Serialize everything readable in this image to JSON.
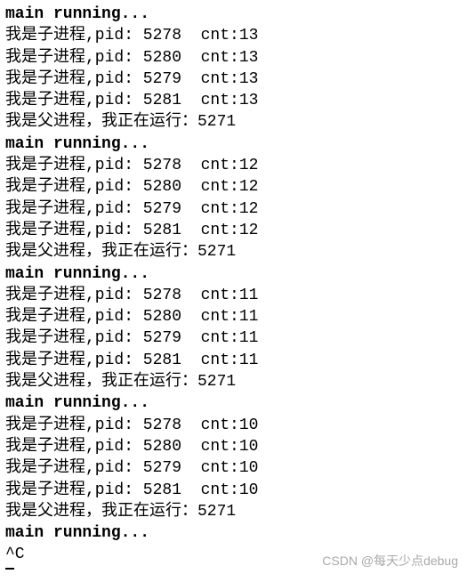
{
  "terminal": {
    "blocks": [
      {
        "header": "main running...",
        "children": [
          {
            "prefix": "我是子进程,pid: ",
            "pid": "5278",
            "sep": "  cnt:",
            "cnt": "13"
          },
          {
            "prefix": "我是子进程,pid: ",
            "pid": "5280",
            "sep": "  cnt:",
            "cnt": "13"
          },
          {
            "prefix": "我是子进程,pid: ",
            "pid": "5279",
            "sep": "  cnt:",
            "cnt": "13"
          },
          {
            "prefix": "我是子进程,pid: ",
            "pid": "5281",
            "sep": "  cnt:",
            "cnt": "13"
          }
        ],
        "parent": {
          "prefix": "我是父进程，我正在运行：",
          "pid": "5271"
        }
      },
      {
        "header": "main running...",
        "children": [
          {
            "prefix": "我是子进程,pid: ",
            "pid": "5278",
            "sep": "  cnt:",
            "cnt": "12"
          },
          {
            "prefix": "我是子进程,pid: ",
            "pid": "5280",
            "sep": "  cnt:",
            "cnt": "12"
          },
          {
            "prefix": "我是子进程,pid: ",
            "pid": "5279",
            "sep": "  cnt:",
            "cnt": "12"
          },
          {
            "prefix": "我是子进程,pid: ",
            "pid": "5281",
            "sep": "  cnt:",
            "cnt": "12"
          }
        ],
        "parent": {
          "prefix": "我是父进程，我正在运行：",
          "pid": "5271"
        }
      },
      {
        "header": "main running...",
        "children": [
          {
            "prefix": "我是子进程,pid: ",
            "pid": "5278",
            "sep": "  cnt:",
            "cnt": "11"
          },
          {
            "prefix": "我是子进程,pid: ",
            "pid": "5280",
            "sep": "  cnt:",
            "cnt": "11"
          },
          {
            "prefix": "我是子进程,pid: ",
            "pid": "5279",
            "sep": "  cnt:",
            "cnt": "11"
          },
          {
            "prefix": "我是子进程,pid: ",
            "pid": "5281",
            "sep": "  cnt:",
            "cnt": "11"
          }
        ],
        "parent": {
          "prefix": "我是父进程，我正在运行：",
          "pid": "5271"
        }
      },
      {
        "header": "main running...",
        "children": [
          {
            "prefix": "我是子进程,pid: ",
            "pid": "5278",
            "sep": "  cnt:",
            "cnt": "10"
          },
          {
            "prefix": "我是子进程,pid: ",
            "pid": "5280",
            "sep": "  cnt:",
            "cnt": "10"
          },
          {
            "prefix": "我是子进程,pid: ",
            "pid": "5279",
            "sep": "  cnt:",
            "cnt": "10"
          },
          {
            "prefix": "我是子进程,pid: ",
            "pid": "5281",
            "sep": "  cnt:",
            "cnt": "10"
          }
        ],
        "parent": {
          "prefix": "我是父进程，我正在运行：",
          "pid": "5271"
        }
      }
    ],
    "trailing_header": "main running...",
    "interrupt": "^C"
  },
  "watermark": "CSDN @每天少点debug"
}
